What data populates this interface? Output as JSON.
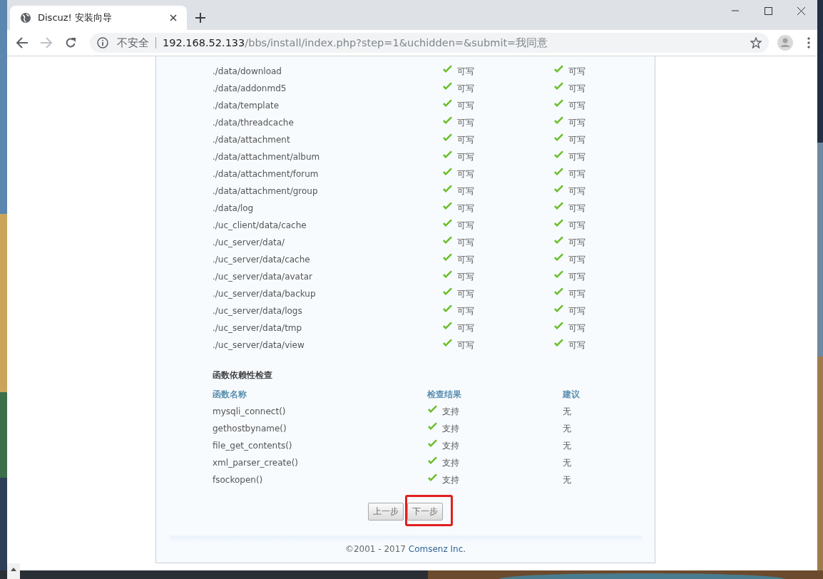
{
  "window": {
    "tabs": [
      {
        "title": "Discuz! 安装向导",
        "selected": true
      }
    ],
    "address": {
      "security": "不安全",
      "host": "192.168.52.133",
      "path": "/bbs/install/index.php?step=1&uchidden=&submit=我同意"
    }
  },
  "directory_check": {
    "rows": [
      {
        "path": "./data/download",
        "current": {
          "text": "可写",
          "ok": true
        },
        "required": {
          "text": "可写",
          "ok": true
        }
      },
      {
        "path": "./data/addonmd5",
        "current": {
          "text": "可写",
          "ok": true
        },
        "required": {
          "text": "可写",
          "ok": true
        }
      },
      {
        "path": "./data/template",
        "current": {
          "text": "可写",
          "ok": true
        },
        "required": {
          "text": "可写",
          "ok": true
        }
      },
      {
        "path": "./data/threadcache",
        "current": {
          "text": "可写",
          "ok": true
        },
        "required": {
          "text": "可写",
          "ok": true
        }
      },
      {
        "path": "./data/attachment",
        "current": {
          "text": "可写",
          "ok": true
        },
        "required": {
          "text": "可写",
          "ok": true
        }
      },
      {
        "path": "./data/attachment/album",
        "current": {
          "text": "可写",
          "ok": true
        },
        "required": {
          "text": "可写",
          "ok": true
        }
      },
      {
        "path": "./data/attachment/forum",
        "current": {
          "text": "可写",
          "ok": true
        },
        "required": {
          "text": "可写",
          "ok": true
        }
      },
      {
        "path": "./data/attachment/group",
        "current": {
          "text": "可写",
          "ok": true
        },
        "required": {
          "text": "可写",
          "ok": true
        }
      },
      {
        "path": "./data/log",
        "current": {
          "text": "可写",
          "ok": true
        },
        "required": {
          "text": "可写",
          "ok": true
        }
      },
      {
        "path": "./uc_client/data/cache",
        "current": {
          "text": "可写",
          "ok": true
        },
        "required": {
          "text": "可写",
          "ok": true
        }
      },
      {
        "path": "./uc_server/data/",
        "current": {
          "text": "可写",
          "ok": true
        },
        "required": {
          "text": "可写",
          "ok": true
        }
      },
      {
        "path": "./uc_server/data/cache",
        "current": {
          "text": "可写",
          "ok": true
        },
        "required": {
          "text": "可写",
          "ok": true
        }
      },
      {
        "path": "./uc_server/data/avatar",
        "current": {
          "text": "可写",
          "ok": true
        },
        "required": {
          "text": "可写",
          "ok": true
        }
      },
      {
        "path": "./uc_server/data/backup",
        "current": {
          "text": "可写",
          "ok": true
        },
        "required": {
          "text": "可写",
          "ok": true
        }
      },
      {
        "path": "./uc_server/data/logs",
        "current": {
          "text": "可写",
          "ok": true
        },
        "required": {
          "text": "可写",
          "ok": true
        }
      },
      {
        "path": "./uc_server/data/tmp",
        "current": {
          "text": "可写",
          "ok": true
        },
        "required": {
          "text": "可写",
          "ok": true
        }
      },
      {
        "path": "./uc_server/data/view",
        "current": {
          "text": "可写",
          "ok": true
        },
        "required": {
          "text": "可写",
          "ok": true
        }
      }
    ]
  },
  "function_check": {
    "title": "函数依赖性检查",
    "columns": [
      "函数名称",
      "检查结果",
      "建议"
    ],
    "rows": [
      {
        "name": "mysqli_connect()",
        "result": {
          "text": "支持",
          "ok": true
        },
        "advice": "无"
      },
      {
        "name": "gethostbyname()",
        "result": {
          "text": "支持",
          "ok": true
        },
        "advice": "无"
      },
      {
        "name": "file_get_contents()",
        "result": {
          "text": "支持",
          "ok": true
        },
        "advice": "无"
      },
      {
        "name": "xml_parser_create()",
        "result": {
          "text": "支持",
          "ok": true
        },
        "advice": "无"
      },
      {
        "name": "fsockopen()",
        "result": {
          "text": "支持",
          "ok": true
        },
        "advice": "无"
      }
    ]
  },
  "buttons": [
    {
      "label": "上一步",
      "highlighted": false
    },
    {
      "label": "下一步",
      "highlighted": true
    }
  ],
  "footer": {
    "copyright": "©2001 - 2017",
    "company": "Comsenz Inc."
  }
}
